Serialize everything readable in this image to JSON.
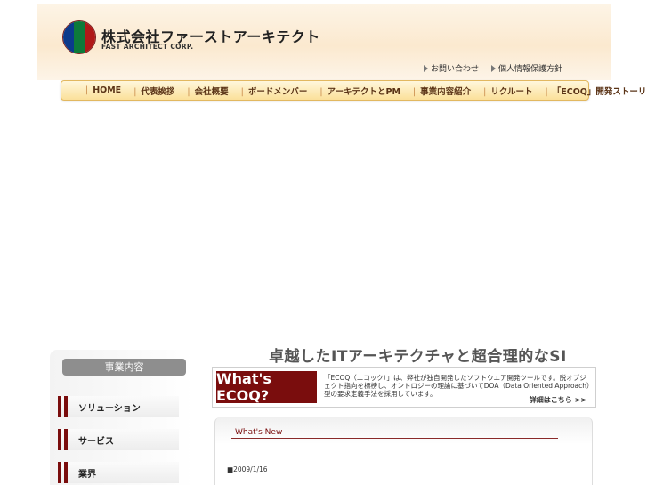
{
  "company": {
    "name": "株式会社ファーストアーキテクト",
    "name_en": "FAST ARCHITECT CORP.",
    "logo_colors": [
      "#0b3a8c",
      "#ffffff",
      "#0d7a3a",
      "#b01818"
    ]
  },
  "util_links": [
    "お問い合わせ",
    "個人情報保護方針"
  ],
  "nav": [
    "HOME",
    "代表挨拶",
    "会社概要",
    "ボードメンバー",
    "アーキテクトとPM",
    "事業内容紹介",
    "リクルート",
    "「ECOQ」開発ストーリー"
  ],
  "sidebar": {
    "title": "事業内容",
    "items": [
      "ソリューション",
      "サービス",
      "業界"
    ]
  },
  "main": {
    "tagline": "卓越したITアーキテクチャと超合理的なSI",
    "ecoq": {
      "badge": "What's ECOQ?",
      "description": "「ECOQ（エコック）」は、弊社が独自開発したソフトウエア開発ツールです。脱オブジェクト指向を標榜し、オントロジーの理論に基づいてDOA（Data Oriented Approach）型の要求定義手法を採用しています。",
      "more": "詳細はこちら >>"
    },
    "news": {
      "title": "What's New",
      "items": [
        {
          "date": "■2009/1/16"
        }
      ]
    }
  },
  "colors": {
    "accent": "#7a0d0d",
    "nav_bg": "#fbe09a"
  }
}
